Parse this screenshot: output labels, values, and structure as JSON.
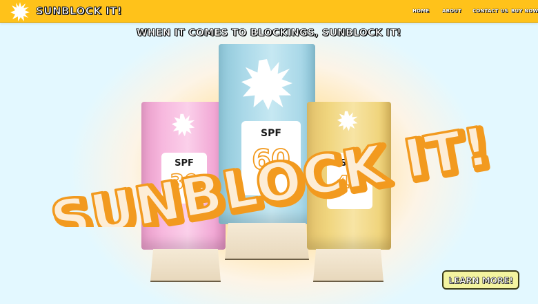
{
  "brand": {
    "name": "SUNBLOCK IT!"
  },
  "nav": {
    "items": [
      "HOME",
      "ABOUT",
      "CONTACT US",
      "BUY NOW"
    ]
  },
  "hero": {
    "tagline": "WHEN IT COMES TO BLOCKINGS, SUNBLOCK IT!",
    "headline": "SUNBLOCK IT!",
    "cta_label": "LEARN MORE!"
  },
  "products": [
    {
      "spf_label": "SPF",
      "spf_value": "30",
      "color": "#f7b8de"
    },
    {
      "spf_label": "SPF",
      "spf_value": "60",
      "color": "#a9d8e8"
    },
    {
      "spf_label": "SPF",
      "spf_value": "40",
      "color": "#f0d57e"
    }
  ],
  "colors": {
    "topbar": "#ffc21a",
    "headline_fill": "#ffffff",
    "headline_outline": "#f29a1f",
    "cap": "#eedfc6"
  }
}
